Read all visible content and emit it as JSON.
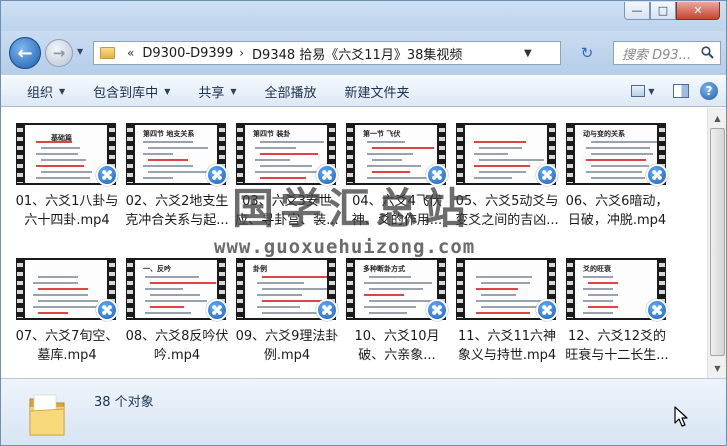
{
  "window": {
    "minimize_glyph": "—",
    "maximize_glyph": "□",
    "close_glyph": "✕"
  },
  "address": {
    "overflow_glyph": "«",
    "crumbs": [
      "D9300-D9399",
      "D9348 拾易《六爻11月》38集视频"
    ],
    "separator": "›"
  },
  "search": {
    "placeholder": "搜索 D93..."
  },
  "toolbar": {
    "organize": "组织",
    "include_in_library": "包含到库中",
    "share": "共享",
    "play_all": "全部播放",
    "new_folder": "新建文件夹"
  },
  "files": [
    {
      "name": "01、六爻1八卦与六十四卦.mp4",
      "thumb_title": "基础篇"
    },
    {
      "name": "02、六爻2地支生克冲合关系与起...",
      "thumb_title": "第四节 地支关系"
    },
    {
      "name": "03、六爻3安世应、寻卦宫、装...",
      "thumb_title": "第四节 装卦"
    },
    {
      "name": "04、六爻4飞伏神、爻的作用...",
      "thumb_title": "第一节 飞伏"
    },
    {
      "name": "05、六爻5动爻与变爻之间的吉凶...",
      "thumb_title": ""
    },
    {
      "name": "06、六爻6暗动，日破，冲脱.mp4",
      "thumb_title": "动与变的关系"
    },
    {
      "name": "07、六爻7旬空、墓库.mp4",
      "thumb_title": ""
    },
    {
      "name": "08、六爻8反吟伏吟.mp4",
      "thumb_title": "一、反吟"
    },
    {
      "name": "09、六爻9理法卦例.mp4",
      "thumb_title": "卦例"
    },
    {
      "name": "10、六爻10月破、六亲象...",
      "thumb_title": "多种断卦方式"
    },
    {
      "name": "11、六爻11六神象义与持世.mp4",
      "thumb_title": ""
    },
    {
      "name": "12、六爻12爻的旺衰与十二长生...",
      "thumb_title": "爻的旺衰"
    }
  ],
  "watermark": {
    "text": "国学汇总站",
    "url": "www.guoxuehuizong.com"
  },
  "status": {
    "count_text": "38 个对象"
  },
  "icons": {
    "back": "back-arrow-icon",
    "forward": "forward-arrow-icon",
    "refresh": "refresh-icon",
    "search": "search-icon",
    "help": "help-icon"
  },
  "colors": {
    "accent": "#1d5fae",
    "toolbar_text": "#1e3150",
    "folder": "#e3b24a"
  }
}
